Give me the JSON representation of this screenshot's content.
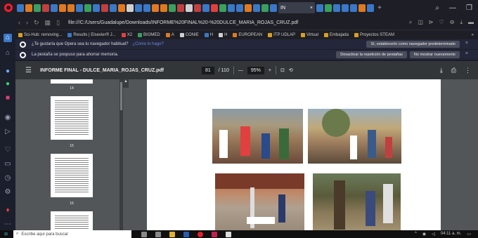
{
  "browser": {
    "active_tab_label": "IN",
    "address": {
      "url": "file:///C:/Users/Guadalupe/Downloads/INFORME%20FINAL%20-%20DULCE_MARIA_ROJAS_CRUZ.pdf"
    },
    "bookmarks": [
      {
        "label": "Sci-Hub: removing...",
        "color": "#d8a020"
      },
      {
        "label": "Results | Elsevier® J...",
        "color": "#3a78c8"
      },
      {
        "label": "X2",
        "color": "#e04040"
      },
      {
        "label": "BIOMED",
        "color": "#3aa060"
      },
      {
        "label": "A",
        "color": "#e07a20"
      },
      {
        "label": "CONIE",
        "color": "#d0d0d0"
      },
      {
        "label": "H",
        "color": "#3a78c8"
      },
      {
        "label": "H",
        "color": "#d0d0d0"
      },
      {
        "label": "EUROPEAN",
        "color": "#e07a20"
      },
      {
        "label": "ITP UDLAP",
        "color": "#d8a020"
      },
      {
        "label": "Virtual",
        "color": "#d8a020"
      },
      {
        "label": "Embajada",
        "color": "#d8a020"
      },
      {
        "label": "Proyectos STEAM",
        "color": "#d8a020"
      }
    ],
    "more_bookmarks": "»"
  },
  "notifications": [
    {
      "text": "¿Te gustaría que Opera sea tu navegador habitual?",
      "link": "¿Cómo lo hago?",
      "buttons": [
        "Sí, establecerlo como navegador predeterminado"
      ],
      "close": "×"
    },
    {
      "text": "La pestaña se pospuso para ahorrar memoria.",
      "link": "",
      "buttons": [
        "Desactivar la repetición de pestañas",
        "No mostrar nuevamente"
      ],
      "close": "×"
    }
  ],
  "pdf": {
    "title": "INFORME FINAL - DULCE_MARIA_ROJAS_CRUZ.pdf",
    "page": "81",
    "total": "/ 110",
    "zoom": "95%",
    "minus": "—",
    "plus": "+",
    "thumbnails": [
      "14",
      "15",
      "16"
    ]
  },
  "taskbar": {
    "search_placeholder": "Escribe aquí para buscar",
    "time": "04:11 a. m."
  }
}
